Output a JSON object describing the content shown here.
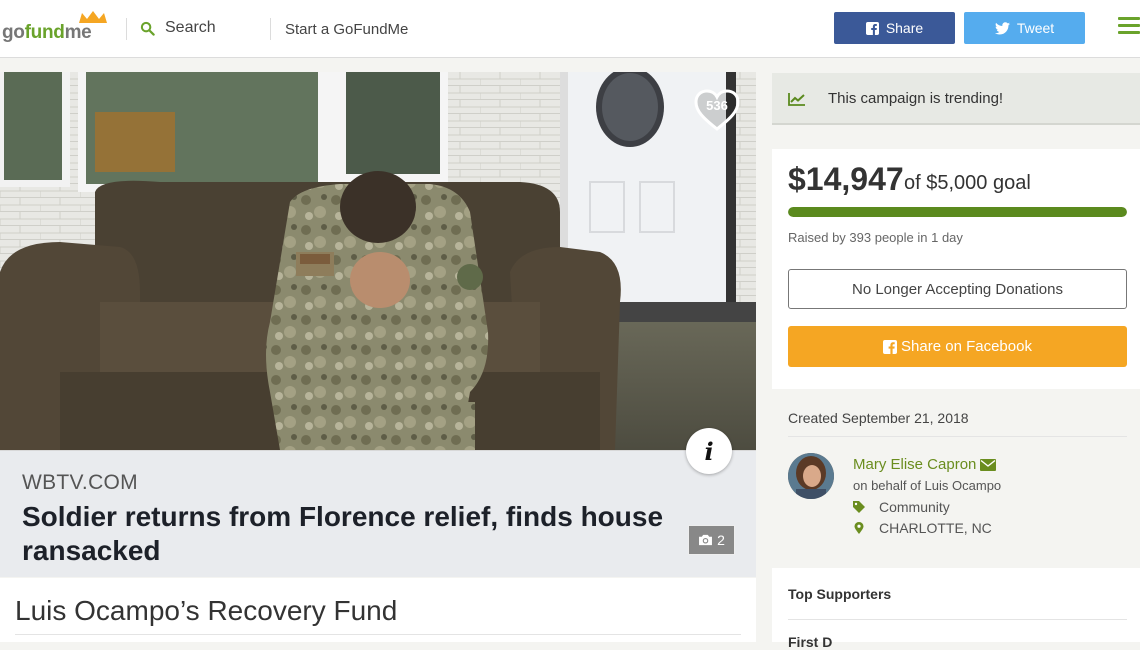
{
  "header": {
    "logo": {
      "part1": "go",
      "part2": "fund",
      "part3": "me"
    },
    "search_label": "Search",
    "start_label": "Start a GoFundMe",
    "share_label": "Share",
    "tweet_label": "Tweet",
    "menu_icon": "hamburger-icon"
  },
  "hero": {
    "heart_count": "536",
    "info_icon": "i",
    "link_domain": "WBTV.COM",
    "link_title": "Soldier returns from Florence relief, finds house ransacked",
    "photo_count": "2"
  },
  "campaign": {
    "title": "Luis Ocampo’s Recovery Fund"
  },
  "sidebar": {
    "trending": "This campaign is trending!",
    "raised_amount": "$14,947",
    "goal_text": "of $5,000 goal",
    "progress_fraction": 1.0,
    "raised_by": "Raised by 393 people in 1 day",
    "no_longer": "No Longer Accepting Donations",
    "share_facebook": "Share on Facebook",
    "created": "Created September 21, 2018",
    "organizer": "Mary Elise Capron",
    "on_behalf": "on behalf of Luis Ocampo",
    "category": "Community",
    "location": "CHARLOTTE, NC",
    "top_supporters": "Top Supporters",
    "first_donors": "First D"
  },
  "colors": {
    "brand_green": "#6aa32b",
    "facebook_blue": "#3b5998",
    "twitter_blue": "#55acee",
    "progress_green": "#5b8a1e",
    "share_orange": "#f5a623"
  }
}
